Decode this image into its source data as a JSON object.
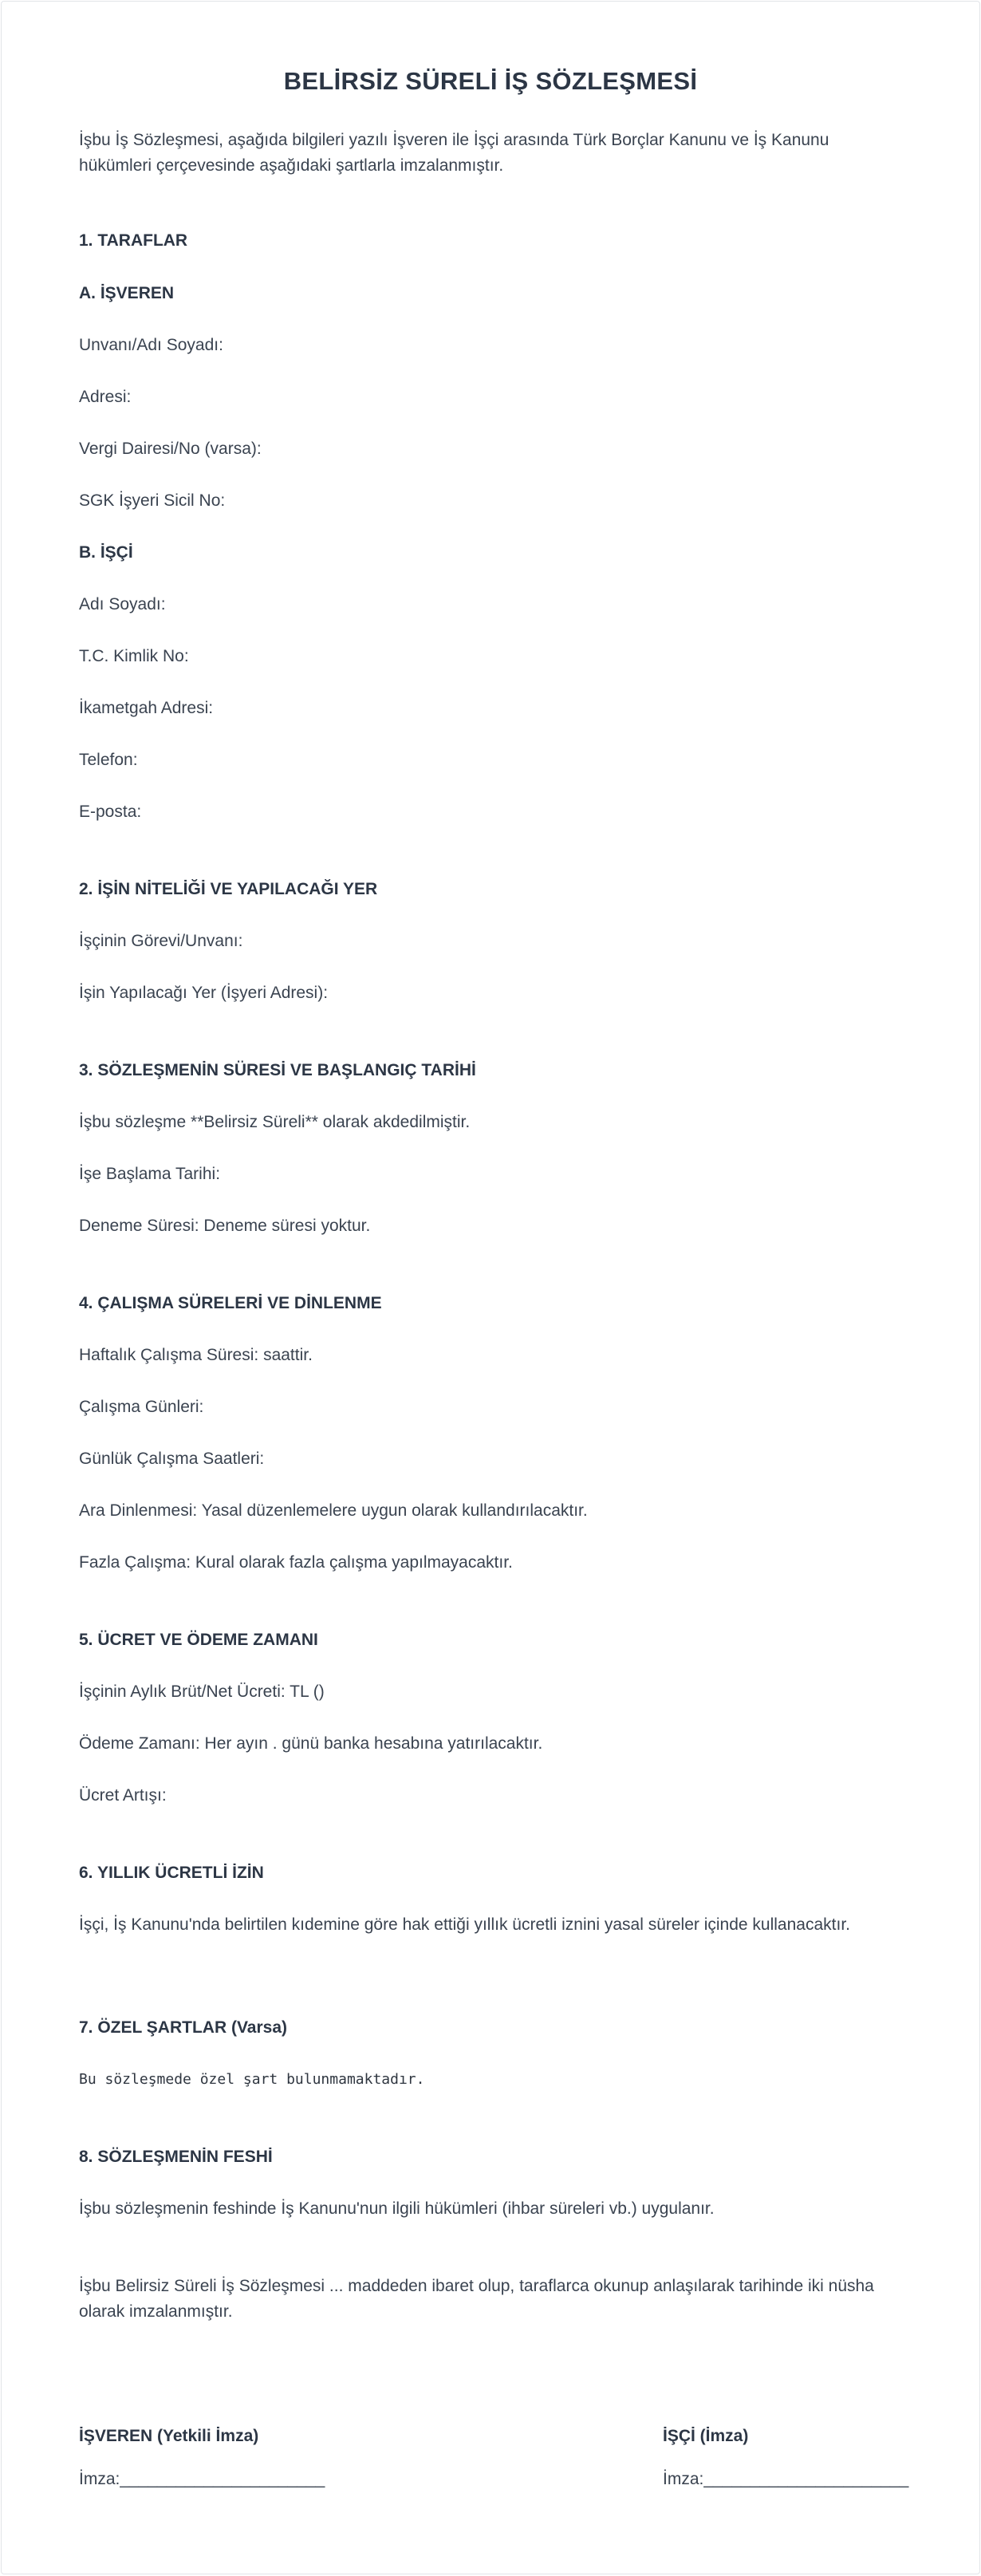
{
  "document": {
    "title": "BELİRSİZ SÜRELİ İŞ SÖZLEŞMESİ",
    "intro": "İşbu İş Sözleşmesi, aşağıda bilgileri yazılı İşveren ile İşçi arasında Türk Borçlar Kanunu ve İş Kanunu hükümleri çerçevesinde aşağıdaki şartlarla imzalanmıştır."
  },
  "section1": {
    "heading": "1. TARAFLAR",
    "employer": {
      "heading": "A. İŞVEREN",
      "name": "Unvanı/Adı Soyadı:",
      "address": "Adresi:",
      "tax": "Vergi Dairesi/No (varsa):",
      "sgk": "SGK İşyeri Sicil No:"
    },
    "employee": {
      "heading": "B. İŞÇİ",
      "name": "Adı Soyadı:",
      "tc": "T.C. Kimlik No:",
      "address": "İkametgah Adresi:",
      "phone": "Telefon:",
      "email": "E-posta:"
    }
  },
  "section2": {
    "heading": "2. İŞİN NİTELİĞİ VE YAPILACAĞI YER",
    "role": "İşçinin Görevi/Unvanı:",
    "place": "İşin Yapılacağı Yer (İşyeri Adresi):"
  },
  "section3": {
    "heading": "3. SÖZLEŞMENİN SÜRESİ VE BAŞLANGIÇ TARİHİ",
    "term": "İşbu sözleşme **Belirsiz Süreli** olarak akdedilmiştir.",
    "start": "İşe Başlama Tarihi:",
    "trial": "Deneme Süresi: Deneme süresi yoktur."
  },
  "section4": {
    "heading": "4. ÇALIŞMA SÜRELERİ VE DİNLENME",
    "weekly": "Haftalık Çalışma Süresi:  saattir.",
    "days": "Çalışma Günleri:",
    "hours": "Günlük Çalışma Saatleri:",
    "break": "Ara Dinlenmesi: Yasal düzenlemelere uygun olarak kullandırılacaktır.",
    "overtime": "Fazla Çalışma: Kural olarak fazla çalışma yapılmayacaktır."
  },
  "section5": {
    "heading": "5. ÜCRET VE ÖDEME ZAMANI",
    "wage": "İşçinin Aylık Brüt/Net Ücreti:  TL ()",
    "payment": "Ödeme Zamanı: Her ayın . günü banka hesabına yatırılacaktır.",
    "raise": "Ücret Artışı:"
  },
  "section6": {
    "heading": "6. YILLIK ÜCRETLİ İZİN",
    "text": "İşçi, İş Kanunu'nda belirtilen kıdemine göre hak ettiği yıllık ücretli iznini yasal süreler içinde kullanacaktır."
  },
  "section7": {
    "heading": "7. ÖZEL ŞARTLAR (Varsa)",
    "text": "Bu sözleşmede özel şart bulunmamaktadır."
  },
  "section8": {
    "heading": "8. SÖZLEŞMENİN FESHİ",
    "text": "İşbu sözleşmenin feshinde İş Kanunu'nun ilgili hükümleri (ihbar süreleri vb.) uygulanır."
  },
  "closing": {
    "text": "İşbu Belirsiz Süreli İş Sözleşmesi ... maddeden ibaret olup, taraflarca okunup anlaşılarak  tarihinde iki nüsha olarak imzalanmıştır."
  },
  "signatures": {
    "employer_title": "İŞVEREN (Yetkili İmza)",
    "employer_line": "İmza:______________________",
    "employee_title": "İŞÇİ (İmza)",
    "employee_line": "İmza:______________________"
  }
}
